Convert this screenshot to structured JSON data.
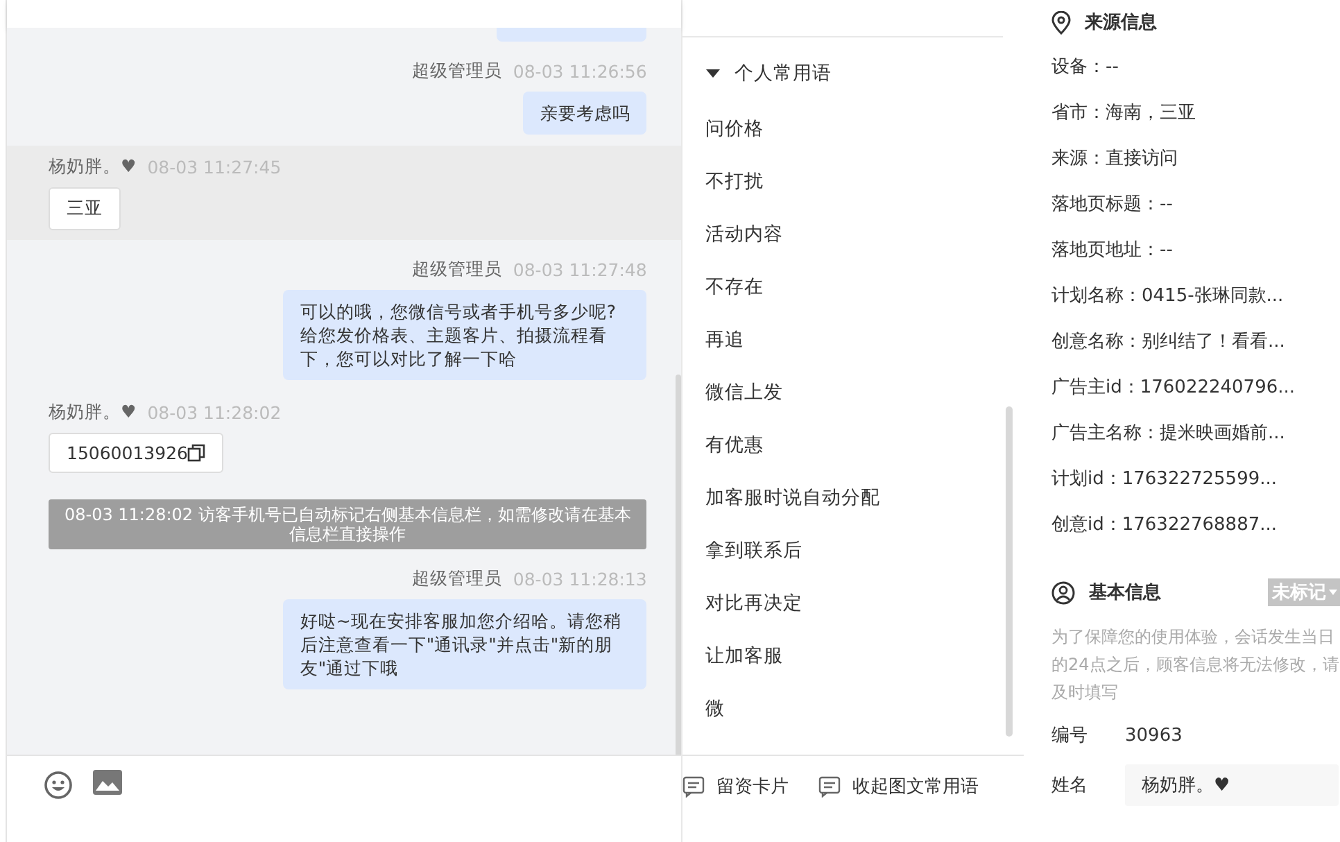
{
  "chat": {
    "messages": [
      {
        "kind": "agent",
        "sender": "超级管理员",
        "time": "08-03 11:26:56",
        "text": "亲要考虑吗"
      },
      {
        "kind": "visitor",
        "sender": "杨奶胖。♥",
        "time": "08-03 11:27:45",
        "text": "三亚",
        "highlighted": true,
        "copyable": false
      },
      {
        "kind": "agent",
        "sender": "超级管理员",
        "time": "08-03 11:27:48",
        "text": "可以的哦，您微信号或者手机号多少呢?给您发价格表、主题客片、拍摄流程看下，您可以对比了解一下哈"
      },
      {
        "kind": "visitor",
        "sender": "杨奶胖。♥",
        "time": "08-03 11:28:02",
        "text": "15060013926",
        "highlighted": false,
        "copyable": true
      },
      {
        "kind": "system",
        "text": "08-03 11:28:02 访客手机号已自动标记右侧基本信息栏，如需修改请在基本信息栏直接操作"
      },
      {
        "kind": "agent",
        "sender": "超级管理员",
        "time": "08-03 11:28:13",
        "text": "好哒~现在安排客服加您介绍哈。请您稍后注意查看一下\"通讯录\"并点击\"新的朋友\"通过下哦"
      }
    ]
  },
  "phrases": {
    "group": {
      "title": "个人常用语",
      "expanded": true
    },
    "items": [
      "问价格",
      "不打扰",
      "活动内容",
      "不存在",
      "再追",
      "微信上发",
      "有优惠",
      "加客服时说自动分配",
      "拿到联系后",
      "对比再决定",
      "让加客服",
      "微"
    ],
    "footer": [
      "留资卡片",
      "收起图文常用语"
    ]
  },
  "source_info": {
    "title": "来源信息",
    "fields": [
      "设备：--",
      "省市：海南，三亚",
      "来源：直接访问",
      "落地页标题：--",
      "落地页地址：--",
      "计划名称：0415-张琳同款...",
      "创意名称：别纠结了！看看...",
      "广告主id：176022240796...",
      "广告主名称：提米映画婚前...",
      "计划id：176322725599...",
      "创意id：176322768887..."
    ]
  },
  "basic_info": {
    "title": "基本信息",
    "tag": "未标记",
    "note": "为了保障您的使用体验，会话发生当日的24点之后，顾客信息将无法修改，请及时填写",
    "id_label": "编号",
    "id_value": "30963",
    "name_label": "姓名",
    "name_value": "杨奶胖。♥"
  }
}
